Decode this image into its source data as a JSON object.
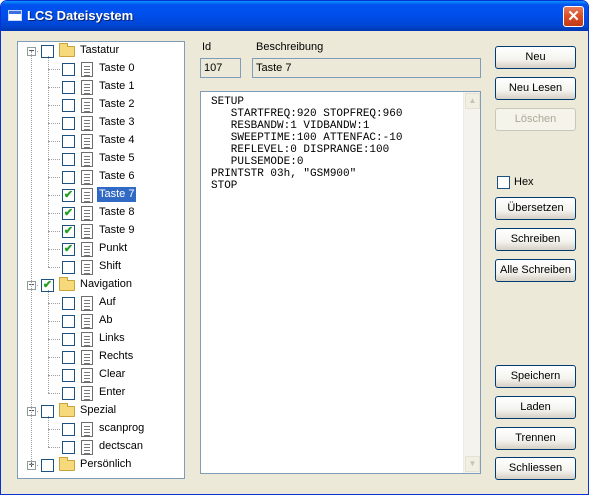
{
  "window": {
    "title": "LCS Dateisystem",
    "close_glyph": "✕"
  },
  "tree": {
    "groups": [
      {
        "label": "Tastatur",
        "expanded": true,
        "checked": false,
        "items": [
          {
            "label": "Taste 0",
            "checked": false
          },
          {
            "label": "Taste 1",
            "checked": false
          },
          {
            "label": "Taste 2",
            "checked": false
          },
          {
            "label": "Taste 3",
            "checked": false
          },
          {
            "label": "Taste 4",
            "checked": false
          },
          {
            "label": "Taste 5",
            "checked": false
          },
          {
            "label": "Taste 6",
            "checked": false
          },
          {
            "label": "Taste 7",
            "checked": true,
            "selected": true
          },
          {
            "label": "Taste 8",
            "checked": true
          },
          {
            "label": "Taste 9",
            "checked": true
          },
          {
            "label": "Punkt",
            "checked": true
          },
          {
            "label": "Shift",
            "checked": false
          }
        ]
      },
      {
        "label": "Navigation",
        "expanded": true,
        "checked": true,
        "items": [
          {
            "label": "Auf",
            "checked": false
          },
          {
            "label": "Ab",
            "checked": false
          },
          {
            "label": "Links",
            "checked": false
          },
          {
            "label": "Rechts",
            "checked": false
          },
          {
            "label": "Clear",
            "checked": false
          },
          {
            "label": "Enter",
            "checked": false
          }
        ]
      },
      {
        "label": "Spezial",
        "expanded": true,
        "checked": false,
        "items": [
          {
            "label": "scanprog",
            "checked": false
          },
          {
            "label": "dectscan",
            "checked": false
          }
        ]
      },
      {
        "label": "Persönlich",
        "expanded": false,
        "checked": false,
        "items": []
      }
    ]
  },
  "details": {
    "id_label": "Id",
    "id_value": "107",
    "desc_label": "Beschreibung",
    "desc_value": "Taste 7",
    "code_text": "SETUP\n   STARTFREQ:920 STOPFREQ:960\n   RESBANDW:1 VIDBANDW:1\n   SWEEPTIME:100 ATTENFAC:-10\n   REFLEVEL:0 DISPRANGE:100\n   PULSEMODE:0\nPRINTSTR 03h, \"GSM900\"\nSTOP"
  },
  "buttons": {
    "neu": "Neu",
    "neu_lesen": "Neu Lesen",
    "loeschen": "Löschen",
    "hex_label": "Hex",
    "hex_checked": false,
    "uebersetzen": "Übersetzen",
    "schreiben": "Schreiben",
    "alle_schreiben": "Alle Schreiben",
    "speichern": "Speichern",
    "laden": "Laden",
    "trennen": "Trennen",
    "schliessen": "Schliessen"
  },
  "icons": {
    "folder": "folder-icon",
    "document": "document-icon",
    "checkmark": "✔",
    "expanded": "−",
    "collapsed": "+",
    "scroll_up": "▲",
    "scroll_down": "▼"
  },
  "colors": {
    "title_bar": "#0053ee",
    "selection": "#316ac5",
    "close_button": "#d94c24",
    "check_green": "#21a121"
  }
}
